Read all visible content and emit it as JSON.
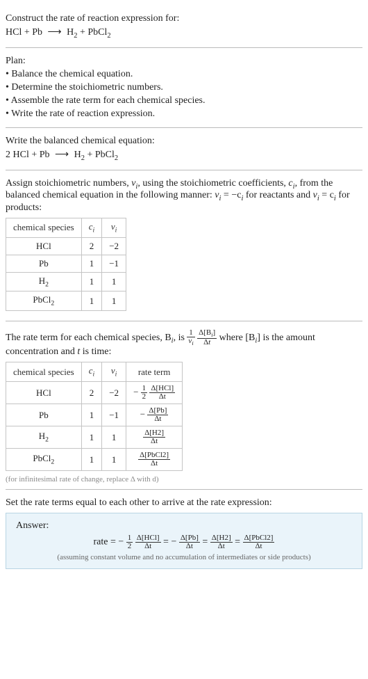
{
  "prompt": {
    "heading": "Construct the rate of reaction expression for:",
    "equation_lhs1": "HCl + Pb",
    "arrow": "⟶",
    "equation_rhs1a": "H",
    "equation_rhs1a_sub": "2",
    "equation_rhs1b": " + PbCl",
    "equation_rhs1b_sub": "2"
  },
  "plan": {
    "heading": "Plan:",
    "b1": "• Balance the chemical equation.",
    "b2": "• Determine the stoichiometric numbers.",
    "b3": "• Assemble the rate term for each chemical species.",
    "b4": "• Write the rate of reaction expression."
  },
  "balanced": {
    "heading": "Write the balanced chemical equation:",
    "lhs": "2 HCl + Pb",
    "arrow": "⟶",
    "rhs1a": "H",
    "rhs1a_sub": "2",
    "rhs1b": " + PbCl",
    "rhs1b_sub": "2"
  },
  "stoich_text": {
    "p1a": "Assign stoichiometric numbers, ",
    "p1b": ", using the stoichiometric coefficients, ",
    "p1c": ", from the balanced chemical equation in the following manner: ",
    "p1d": " for reactants and ",
    "p1e": " for products:",
    "nu_i": "ν",
    "c_i": "c",
    "sub_i": "i",
    "eq1a": "ν",
    "eq1b": " = −c",
    "eq2a": "ν",
    "eq2b": " = c"
  },
  "table1": {
    "h1": "chemical species",
    "h2": "c",
    "h3": "ν",
    "sub_i": "i",
    "r1": {
      "species": "HCl",
      "c": "2",
      "nu": "−2"
    },
    "r2": {
      "species": "Pb",
      "c": "1",
      "nu": "−1"
    },
    "r3": {
      "species_a": "H",
      "species_sub": "2",
      "c": "1",
      "nu": "1"
    },
    "r4": {
      "species_a": "PbCl",
      "species_sub": "2",
      "c": "1",
      "nu": "1"
    }
  },
  "rate_text": {
    "p1a": "The rate term for each chemical species, B",
    "p1b": ", is",
    "frac1_num": "1",
    "frac1_den_a": "ν",
    "frac2_num_a": "Δ[B",
    "frac2_num_b": "]",
    "frac2_den_a": "Δ",
    "frac2_den_b": "t",
    "p1c": " where [B",
    "p1d": "] is the amount concentration and ",
    "t": "t",
    "p1e": " is time:",
    "sub_i": "i"
  },
  "table2": {
    "h1": "chemical species",
    "h2": "c",
    "h3": "ν",
    "h4": "rate term",
    "sub_i": "i",
    "r1": {
      "species": "HCl",
      "c": "2",
      "nu": "−2",
      "prefix": "−",
      "coef_num": "1",
      "coef_den": "2",
      "dnum": "Δ[HCl]",
      "dden": "Δt"
    },
    "r2": {
      "species": "Pb",
      "c": "1",
      "nu": "−1",
      "prefix": "−",
      "dnum": "Δ[Pb]",
      "dden": "Δt"
    },
    "r3": {
      "species_a": "H",
      "species_sub": "2",
      "c": "1",
      "nu": "1",
      "dnum": "Δ[H2]",
      "dden": "Δt"
    },
    "r4": {
      "species_a": "PbCl",
      "species_sub": "2",
      "c": "1",
      "nu": "1",
      "dnum": "Δ[PbCl2]",
      "dden": "Δt"
    }
  },
  "note": "(for infinitesimal rate of change, replace Δ with d)",
  "final": {
    "heading": "Set the rate terms equal to each other to arrive at the rate expression:",
    "answer_label": "Answer:",
    "rate_label": "rate = ",
    "neg": "−",
    "half_num": "1",
    "half_den": "2",
    "t1_num": "Δ[HCl]",
    "t1_den": "Δt",
    "eq": " = ",
    "t2_num": "Δ[Pb]",
    "t2_den": "Δt",
    "t3_num": "Δ[H2]",
    "t3_den": "Δt",
    "t4_num": "Δ[PbCl2]",
    "t4_den": "Δt",
    "assumption": "(assuming constant volume and no accumulation of intermediates or side products)"
  }
}
